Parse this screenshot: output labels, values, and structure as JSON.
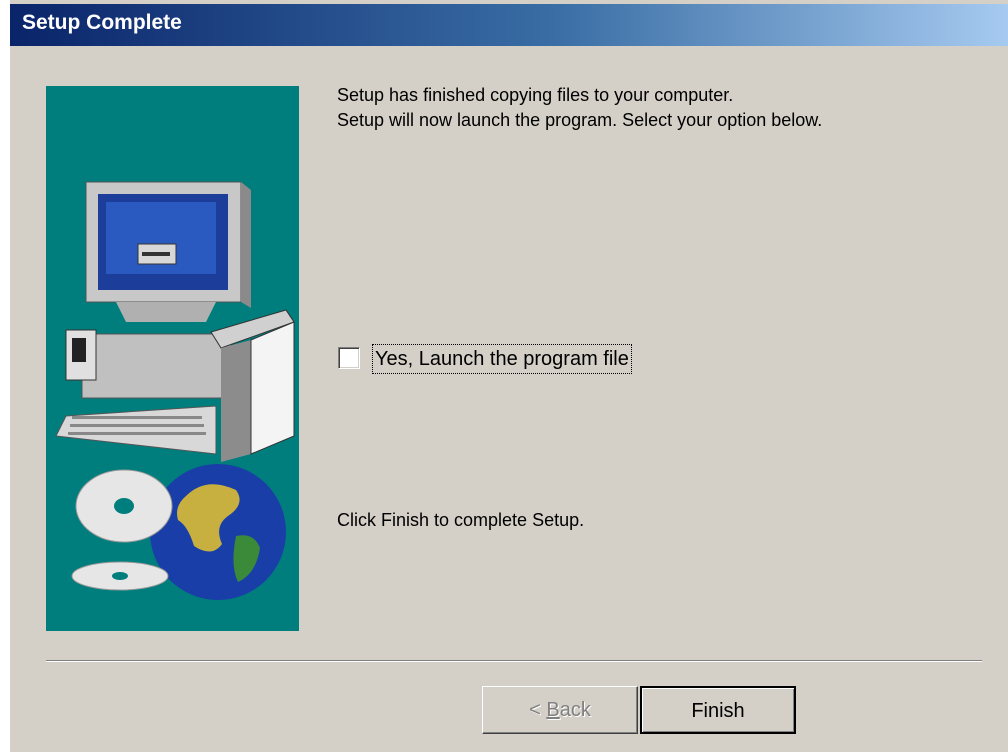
{
  "window": {
    "title": "Setup Complete"
  },
  "intro": {
    "line1": "Setup has finished copying files to your computer.",
    "line2": "Setup will now launch the program. Select your option below."
  },
  "launch_option": {
    "label": "Yes, Launch the program file",
    "checked": false
  },
  "finish_instruction": "Click Finish to complete Setup.",
  "buttons": {
    "back": {
      "prefix": "< ",
      "accel": "B",
      "rest": "ack",
      "enabled": false
    },
    "finish": {
      "label": "Finish",
      "enabled": true
    }
  },
  "colors": {
    "title_gradient_start": "#0a246a",
    "title_gradient_end": "#a6caf0",
    "face": "#d4d0c8",
    "banner": "#007d7d"
  }
}
